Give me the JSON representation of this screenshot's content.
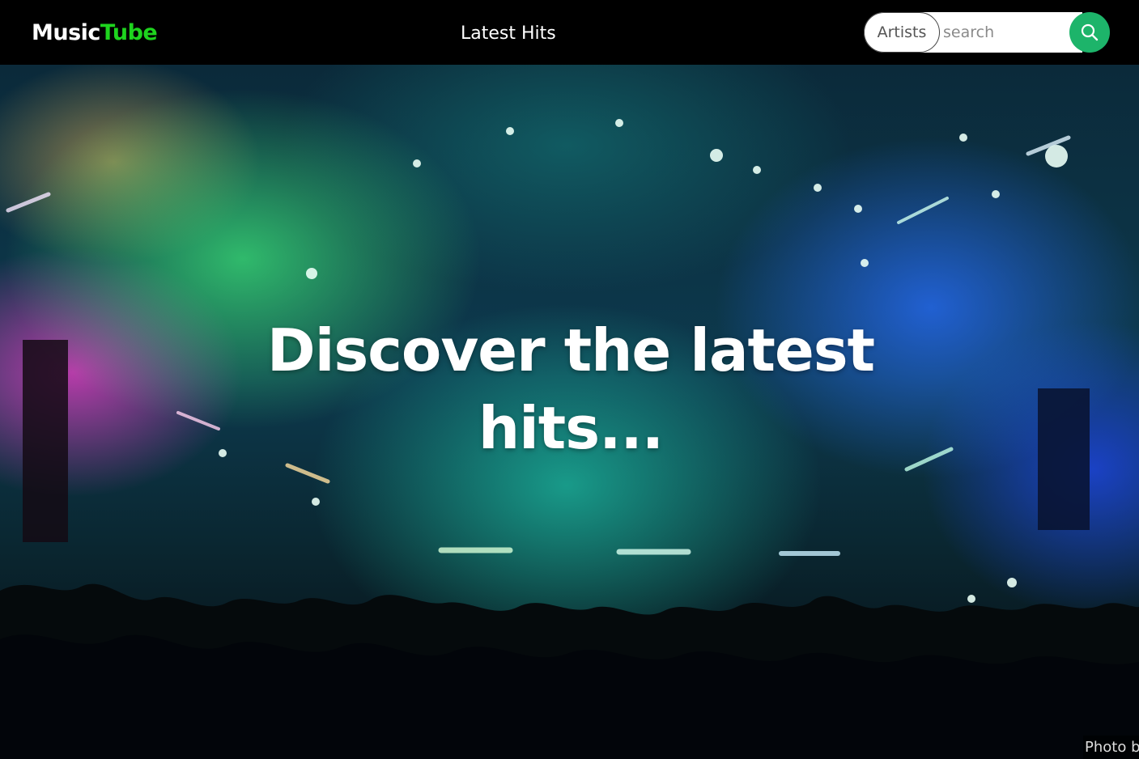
{
  "navbar": {
    "brand_part1": "Music",
    "brand_part2": "Tube",
    "nav_link": "Latest Hits",
    "search": {
      "category": "Artists",
      "placeholder": "search",
      "value": "",
      "button_icon": "search-icon"
    }
  },
  "hero": {
    "headline": "Discover the latest hits...",
    "photo_credit": "Photo b"
  },
  "colors": {
    "navbar_bg": "#000000",
    "brand_accent": "#1ed41e",
    "search_button": "#1db46a"
  }
}
